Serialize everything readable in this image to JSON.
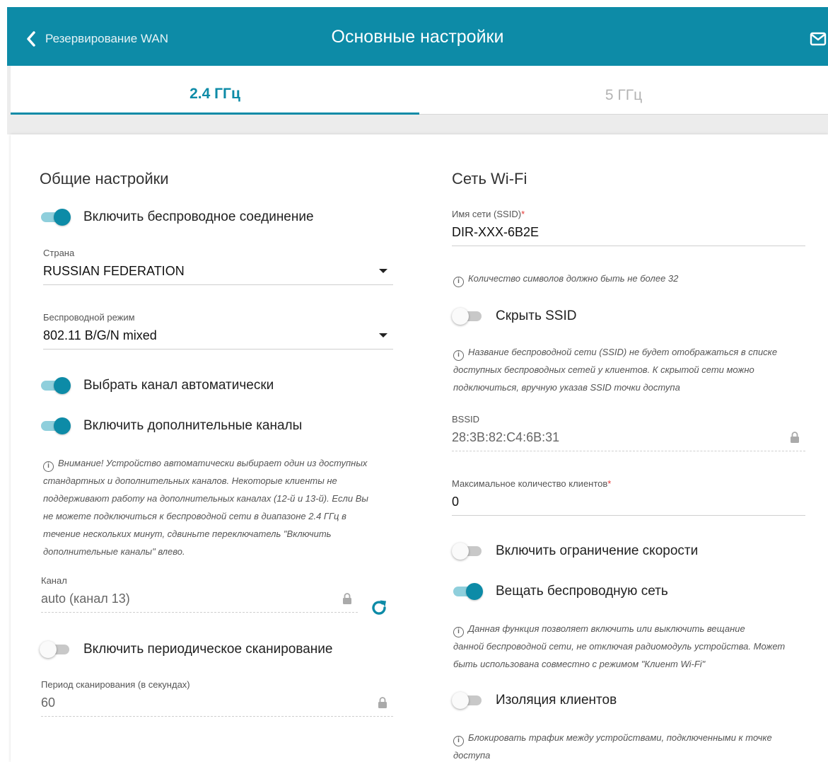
{
  "header": {
    "back_label": "Резервирование WAN",
    "title": "Основные настройки"
  },
  "tabs": [
    {
      "label": "2.4 ГГц",
      "active": true
    },
    {
      "label": "5 ГГц",
      "active": false
    }
  ],
  "left": {
    "section_title": "Общие настройки",
    "enable_wireless": {
      "label": "Включить беспроводное соединение",
      "on": true
    },
    "country": {
      "label": "Страна",
      "value": "RUSSIAN FEDERATION"
    },
    "mode": {
      "label": "Беспроводной режим",
      "value": "802.11 B/G/N mixed"
    },
    "auto_channel": {
      "label": "Выбрать канал автоматически",
      "on": true
    },
    "extra_channels": {
      "label": "Включить дополнительные каналы",
      "on": true
    },
    "warning_lines": [
      "Внимание! Устройство автоматически выбирает один из доступных",
      "стандартных и дополнительных каналов. Некоторые клиенты не",
      "поддерживают работу на дополнительных каналах (12-й и 13-й). Если Вы",
      "не можете подключиться к беспроводной сети в диапазоне 2.4 ГГц в",
      "течение нескольких минут, сдвиньте переключатель \"Включить",
      "дополнительные каналы\" влево."
    ],
    "channel": {
      "label": "Канал",
      "value": "auto (канал 13)"
    },
    "periodic_scan": {
      "label": "Включить периодическое сканирование",
      "on": false
    },
    "scan_period": {
      "label": "Период сканирования (в секундах)",
      "value": "60"
    }
  },
  "right": {
    "section_title": "Сеть Wi-Fi",
    "ssid": {
      "label": "Имя сети (SSID)",
      "required_mark": "*",
      "value": "DIR-XXX-6B2E"
    },
    "ssid_hint": "Количество символов должно быть не более 32",
    "hide_ssid": {
      "label": "Скрыть SSID",
      "on": false
    },
    "hide_hint_lines": [
      "Название беспроводной сети (SSID) не будет отображаться в списке",
      "доступных беспроводных сетей у клиентов. К скрытой сети можно",
      "подключиться, вручную указав SSID точки доступа"
    ],
    "bssid": {
      "label": "BSSID",
      "value": "28:3B:82:C4:6B:31"
    },
    "max_clients": {
      "label": "Максимальное количество клиентов",
      "required_mark": "*",
      "value": "0"
    },
    "speed_limit": {
      "label": "Включить ограничение скорости",
      "on": false
    },
    "broadcast": {
      "label": "Вещать беспроводную сеть",
      "on": true
    },
    "broadcast_hint_lines": [
      "Данная функция позволяет включить или выключить вещание",
      "данной беспроводной сети, не отключая радиомодуль устройства. Может",
      "быть использована совместно с режимом \"Клиент Wi-Fi\""
    ],
    "isolation": {
      "label": "Изоляция клиентов",
      "on": false
    },
    "isolation_hint_lines": [
      "Блокировать трафик между устройствами, подключенными к точке",
      "доступа"
    ]
  },
  "colors": {
    "accent": "#0d8ba7",
    "accent_light": "#8fcfdc",
    "required": "#e53935"
  }
}
